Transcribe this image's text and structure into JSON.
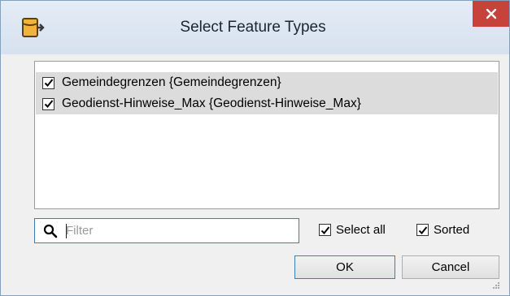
{
  "window": {
    "title": "Select Feature Types"
  },
  "list": {
    "items": [
      {
        "label": "Gemeindegrenzen {Gemeindegrenzen}",
        "checked": true
      },
      {
        "label": "Geodienst-Hinweise_Max {Geodienst-Hinweise_Max}",
        "checked": true
      }
    ]
  },
  "filter": {
    "placeholder": "Filter",
    "value": ""
  },
  "options": {
    "select_all_label": "Select all",
    "select_all_checked": true,
    "sorted_label": "Sorted",
    "sorted_checked": true
  },
  "buttons": {
    "ok_label": "OK",
    "cancel_label": "Cancel"
  },
  "icons": {
    "app": "database-export-icon",
    "close": "close-icon",
    "search": "search-icon",
    "check": "check-icon",
    "grip": "resize-grip-icon"
  },
  "colors": {
    "close_bg": "#c7423b",
    "selection_bg": "#dcdcdc",
    "focus_border": "#3c7fb1"
  }
}
